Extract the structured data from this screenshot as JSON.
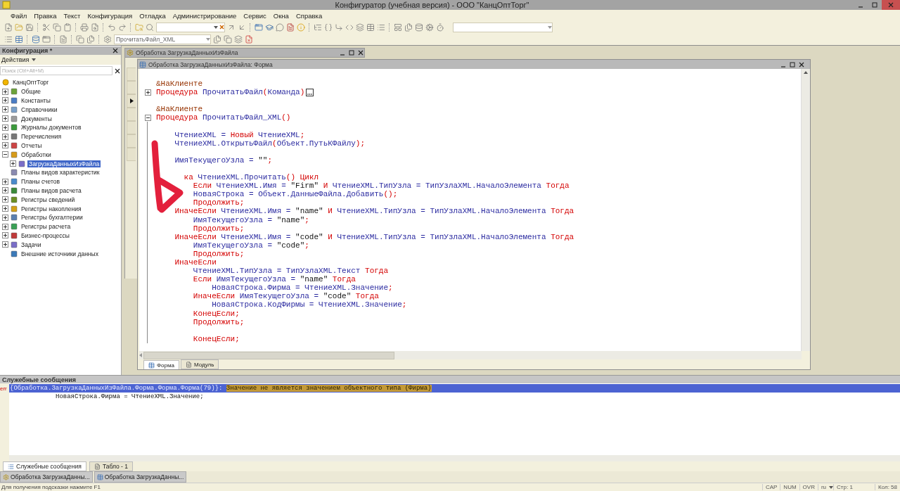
{
  "window": {
    "title": "Конфигуратор (учебная версия) - ООО \"КанцОптТорг\""
  },
  "menu": [
    "Файл",
    "Правка",
    "Текст",
    "Конфигурация",
    "Отладка",
    "Администрирование",
    "Сервис",
    "Окна",
    "Справка"
  ],
  "toolbar": {
    "method_box": {
      "value": "ПрочитатьФайл_XML"
    }
  },
  "config_panel": {
    "title": "Конфигурация *",
    "actions": "Действия",
    "search": {
      "placeholder": "Поиск (Ctrl+Alt+M)"
    },
    "tree": [
      {
        "label": "КанцОптТорг",
        "kind": "root",
        "selected": false,
        "children": [
          {
            "label": "Общие",
            "kind": "group",
            "expanded": false,
            "selected": false
          },
          {
            "label": "Константы",
            "kind": "group",
            "expanded": false,
            "selected": false
          },
          {
            "label": "Справочники",
            "kind": "group",
            "expanded": false,
            "selected": false
          },
          {
            "label": "Документы",
            "kind": "group",
            "expanded": false,
            "selected": false
          },
          {
            "label": "Журналы документов",
            "kind": "group",
            "expanded": false,
            "selected": false
          },
          {
            "label": "Перечисления",
            "kind": "group",
            "expanded": false,
            "selected": false
          },
          {
            "label": "Отчеты",
            "kind": "group",
            "expanded": false,
            "selected": false
          },
          {
            "label": "Обработки",
            "kind": "group",
            "expanded": true,
            "selected": false,
            "children": [
              {
                "label": "ЗагрузкаДанныхИзФайла",
                "kind": "group",
                "expanded": false,
                "selected": true
              }
            ]
          },
          {
            "label": "Планы видов характеристик",
            "kind": "leaf",
            "selected": false
          },
          {
            "label": "Планы счетов",
            "kind": "group",
            "expanded": false,
            "selected": false
          },
          {
            "label": "Планы видов расчета",
            "kind": "group",
            "expanded": false,
            "selected": false
          },
          {
            "label": "Регистры сведений",
            "kind": "group",
            "expanded": false,
            "selected": false
          },
          {
            "label": "Регистры накопления",
            "kind": "group",
            "expanded": false,
            "selected": false
          },
          {
            "label": "Регистры бухгалтерии",
            "kind": "group",
            "expanded": false,
            "selected": false
          },
          {
            "label": "Регистры расчета",
            "kind": "group",
            "expanded": false,
            "selected": false
          },
          {
            "label": "Бизнес-процессы",
            "kind": "group",
            "expanded": false,
            "selected": false
          },
          {
            "label": "Задачи",
            "kind": "group",
            "expanded": false,
            "selected": false
          },
          {
            "label": "Внешние источники данных",
            "kind": "leaf",
            "selected": false
          }
        ]
      }
    ]
  },
  "document": {
    "title": "Обработка ЗагрузкаДанныхИзФайла",
    "form_window": {
      "title": "Обработка ЗагрузкаДанныхИзФайла: Форма",
      "code": [
        {
          "kind": "code",
          "tokens": [
            {
              "kind": "dir",
              "text": "&НаКлиенте"
            }
          ]
        },
        {
          "kind": "code",
          "collapsed": true,
          "tokens": [
            {
              "kind": "kw",
              "text": "Процедура "
            },
            {
              "kind": "id",
              "text": "ПрочитатьФайл"
            },
            {
              "kind": "kw",
              "text": "("
            },
            {
              "kind": "id",
              "text": "Команда"
            },
            {
              "kind": "kw",
              "text": ")"
            }
          ]
        },
        {
          "kind": "blank"
        },
        {
          "kind": "code",
          "tokens": [
            {
              "kind": "dir",
              "text": "&НаКлиенте"
            }
          ]
        },
        {
          "kind": "code",
          "collapsed": false,
          "tokens": [
            {
              "kind": "kw",
              "text": "Процедура "
            },
            {
              "kind": "id",
              "text": "ПрочитатьФайл_XML"
            },
            {
              "kind": "kw",
              "text": "()"
            }
          ]
        },
        {
          "kind": "blank"
        },
        {
          "kind": "code",
          "tokens": [
            {
              "kind": "id",
              "text": "    ЧтениеXML = "
            },
            {
              "kind": "kw",
              "text": "Новый"
            },
            {
              "kind": "id",
              "text": " ЧтениеXML"
            },
            {
              "kind": "kw",
              "text": ";"
            }
          ]
        },
        {
          "kind": "code",
          "tokens": [
            {
              "kind": "id",
              "text": "    ЧтениеXML.ОткрытьФайл"
            },
            {
              "kind": "kw",
              "text": "("
            },
            {
              "kind": "id",
              "text": "Объект.ПутьКФайлу"
            },
            {
              "kind": "kw",
              "text": ");"
            }
          ]
        },
        {
          "kind": "blank"
        },
        {
          "kind": "code",
          "tokens": [
            {
              "kind": "id",
              "text": "    ИмяТекущегоУзла = "
            },
            {
              "kind": "str",
              "text": "\"\""
            },
            {
              "kind": "kw",
              "text": ";"
            }
          ]
        },
        {
          "kind": "blank"
        },
        {
          "kind": "code",
          "tokens": [
            {
              "kind": "kw",
              "text": "      ка "
            },
            {
              "kind": "id",
              "text": "ЧтениеXML.Прочитать"
            },
            {
              "kind": "kw",
              "text": "() Цикл"
            }
          ]
        },
        {
          "kind": "code",
          "tokens": [
            {
              "kind": "kw",
              "text": "        Если "
            },
            {
              "kind": "id",
              "text": "ЧтениеXML.Имя = "
            },
            {
              "kind": "str",
              "text": "\"Firm\""
            },
            {
              "kind": "kw",
              "text": " И "
            },
            {
              "kind": "id",
              "text": "ЧтениеXML.ТипУзла = ТипУзлаXML.НачалоЭлемента "
            },
            {
              "kind": "kw",
              "text": "Тогда"
            }
          ]
        },
        {
          "kind": "code",
          "tokens": [
            {
              "kind": "id",
              "text": "        НоваяСтрока = Объект.ДанныеФайла.Добавить"
            },
            {
              "kind": "kw",
              "text": "();"
            }
          ]
        },
        {
          "kind": "code",
          "tokens": [
            {
              "kind": "kw",
              "text": "        Продолжить;"
            }
          ]
        },
        {
          "kind": "code",
          "tokens": [
            {
              "kind": "kw",
              "text": "    ИначеЕсли "
            },
            {
              "kind": "id",
              "text": "ЧтениеXML.Имя = "
            },
            {
              "kind": "str",
              "text": "\"name\""
            },
            {
              "kind": "kw",
              "text": " И "
            },
            {
              "kind": "id",
              "text": "ЧтениеXML.ТипУзла = ТипУзлаXML.НачалоЭлемента "
            },
            {
              "kind": "kw",
              "text": "Тогда"
            }
          ]
        },
        {
          "kind": "code",
          "tokens": [
            {
              "kind": "id",
              "text": "        ИмяТекущегоУзла = "
            },
            {
              "kind": "str",
              "text": "\"name\""
            },
            {
              "kind": "kw",
              "text": ";"
            }
          ]
        },
        {
          "kind": "code",
          "tokens": [
            {
              "kind": "kw",
              "text": "        Продолжить;"
            }
          ]
        },
        {
          "kind": "code",
          "tokens": [
            {
              "kind": "kw",
              "text": "    ИначеЕсли "
            },
            {
              "kind": "id",
              "text": "ЧтениеXML.Имя = "
            },
            {
              "kind": "str",
              "text": "\"code\""
            },
            {
              "kind": "kw",
              "text": " И "
            },
            {
              "kind": "id",
              "text": "ЧтениеXML.ТипУзла = ТипУзлаXML.НачалоЭлемента "
            },
            {
              "kind": "kw",
              "text": "Тогда"
            }
          ]
        },
        {
          "kind": "code",
          "tokens": [
            {
              "kind": "id",
              "text": "        ИмяТекущегоУзла = "
            },
            {
              "kind": "str",
              "text": "\"code\""
            },
            {
              "kind": "kw",
              "text": ";"
            }
          ]
        },
        {
          "kind": "code",
          "tokens": [
            {
              "kind": "kw",
              "text": "        Продолжить;"
            }
          ]
        },
        {
          "kind": "code",
          "tokens": [
            {
              "kind": "kw",
              "text": "    ИначеЕсли"
            }
          ]
        },
        {
          "kind": "code",
          "tokens": [
            {
              "kind": "id",
              "text": "        ЧтениеXML.ТипУзла = ТипУзлаXML.Текст "
            },
            {
              "kind": "kw",
              "text": "Тогда"
            }
          ]
        },
        {
          "kind": "code",
          "tokens": [
            {
              "kind": "kw",
              "text": "        Если "
            },
            {
              "kind": "id",
              "text": "ИмяТекущегоУзла = "
            },
            {
              "kind": "str",
              "text": "\"name\""
            },
            {
              "kind": "kw",
              "text": " Тогда"
            }
          ]
        },
        {
          "kind": "code",
          "tokens": [
            {
              "kind": "id",
              "text": "            НоваяСтрока.Фирма = ЧтениеXML.Значение"
            },
            {
              "kind": "kw",
              "text": ";"
            }
          ]
        },
        {
          "kind": "code",
          "tokens": [
            {
              "kind": "kw",
              "text": "        ИначеЕсли "
            },
            {
              "kind": "id",
              "text": "ИмяТекущегоУзла = "
            },
            {
              "kind": "str",
              "text": "\"code\""
            },
            {
              "kind": "kw",
              "text": " Тогда"
            }
          ]
        },
        {
          "kind": "code",
          "tokens": [
            {
              "kind": "id",
              "text": "            НоваяСтрока.КодФирмы = ЧтениеXML.Значение"
            },
            {
              "kind": "kw",
              "text": ";"
            }
          ]
        },
        {
          "kind": "code",
          "tokens": [
            {
              "kind": "kw",
              "text": "        КонецЕсли;"
            }
          ]
        },
        {
          "kind": "code",
          "tokens": [
            {
              "kind": "kw",
              "text": "        Продолжить;"
            }
          ]
        },
        {
          "kind": "blank"
        },
        {
          "kind": "code",
          "tokens": [
            {
              "kind": "kw",
              "text": "        КонецЕсли;"
            }
          ]
        }
      ],
      "tabs": [
        {
          "label": "Форма",
          "selected": true
        },
        {
          "label": "Модуль",
          "selected": false
        }
      ]
    }
  },
  "messages": {
    "title": "Служебные сообщения",
    "rows": [
      {
        "kind": "error",
        "marker": "err",
        "location": "{Обработка.ЗагрузкаДанныхИзФайла.Форма.Форма.Форма(79)}:",
        "text": "Значение не является значением объектного типа (Фирма)",
        "selected": true
      },
      {
        "kind": "source",
        "text": "НоваяСтрока.Фирма = ЧтениеXML.Значение;",
        "selected": false
      }
    ]
  },
  "bottom_tabs": [
    {
      "label": "Служебные сообщения",
      "selected": true
    },
    {
      "label": "Табло - 1",
      "selected": false
    }
  ],
  "open_windows": [
    {
      "label": "Обработка ЗагрузкаДанны...",
      "selected": false
    },
    {
      "label": "Обработка ЗагрузкаДанны...",
      "selected": false
    }
  ],
  "status_bar": {
    "hint": "Для получения подсказки нажмите F1",
    "indicators": [
      "CAP",
      "NUM",
      "OVR"
    ],
    "language": "ru",
    "line": "Стр: 1",
    "column": "Кол: 58"
  }
}
